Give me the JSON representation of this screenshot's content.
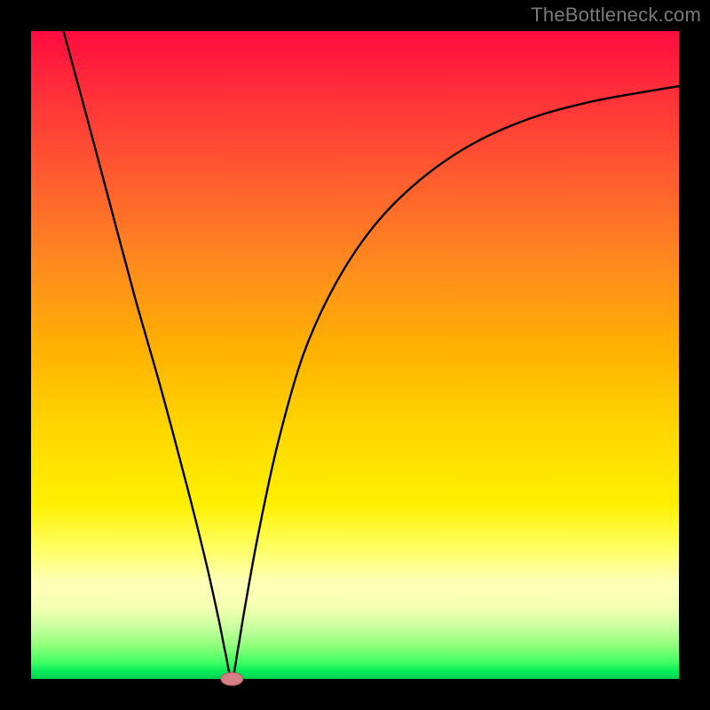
{
  "watermark": {
    "text": "TheBottleneck.com"
  },
  "colors": {
    "frame": "#000000",
    "curve": "#000000",
    "marker_fill": "#d67f86",
    "marker_stroke": "#b85b63",
    "gradient_top": "#ff0b3f",
    "gradient_bottom": "#00d050"
  },
  "chart_data": {
    "type": "line",
    "title": "",
    "xlabel": "",
    "ylabel": "",
    "xlim": [
      0,
      100
    ],
    "ylim": [
      0,
      100
    ],
    "grid": false,
    "legend": false,
    "annotations": [],
    "marker": {
      "x": 31,
      "y": 0,
      "rx": 1.7,
      "ry": 1.0
    },
    "series": [
      {
        "name": "curve",
        "x": [
          5,
          8,
          12,
          16,
          20,
          24,
          27,
          29,
          30,
          31,
          32,
          33,
          35,
          38,
          42,
          47,
          53,
          60,
          68,
          77,
          86,
          94,
          100
        ],
        "y": [
          100,
          89,
          74,
          59,
          45,
          30,
          18,
          9,
          4,
          0,
          5,
          11,
          22,
          36,
          50,
          61,
          70,
          77,
          82.5,
          86.5,
          89,
          90.5,
          91.5
        ]
      }
    ]
  }
}
